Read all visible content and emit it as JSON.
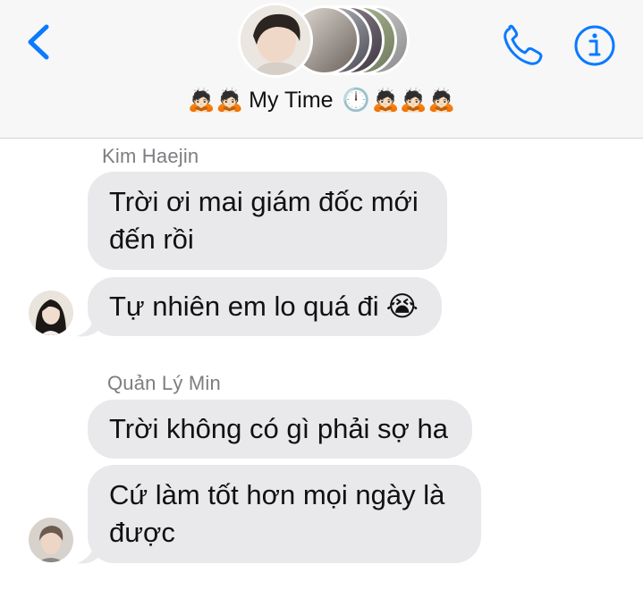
{
  "header": {
    "group_name": "My Time",
    "title_emoji_left": "🙇🏻🙇🏻",
    "title_emoji_clock": "🕛",
    "title_emoji_right": "🙇🏻🙇🏻🙇🏻",
    "accent_color": "#0a7aff",
    "icons": [
      "back-chevron-icon",
      "phone-icon",
      "info-icon"
    ]
  },
  "messages": [
    {
      "sender": "Kim Haejin",
      "bubbles": [
        {
          "lines": [
            "Trời ơi mai giám đốc mới",
            "đến rồi"
          ]
        },
        {
          "text": "Tự nhiên em lo quá đi",
          "emoji": "😭"
        }
      ]
    },
    {
      "sender": "Quản Lý Min",
      "bubbles": [
        {
          "text": "Trời không có gì phải sợ ha"
        },
        {
          "lines": [
            "Cứ làm tốt hơn mọi ngày là",
            "được"
          ]
        }
      ]
    }
  ]
}
